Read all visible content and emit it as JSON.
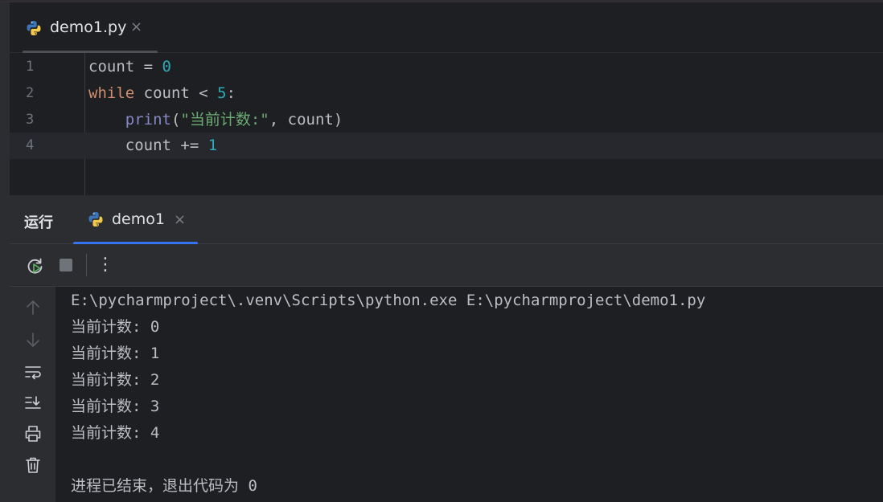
{
  "colors": {
    "background": "#1e1f22",
    "panel": "#2b2d30",
    "keyword": "#cf8e6d",
    "number": "#2aacb8",
    "builtin": "#8888c6",
    "string": "#6aab73",
    "accent": "#3574f0"
  },
  "editor": {
    "tab": {
      "filename": "demo1.py",
      "close_glyph": "×",
      "icon": "python-icon"
    },
    "lines": [
      {
        "num": "1"
      },
      {
        "num": "2"
      },
      {
        "num": "3"
      },
      {
        "num": "4"
      }
    ],
    "code": {
      "l1_var": "count",
      "l1_op": " = ",
      "l1_val": "0",
      "l2_kw": "while",
      "l2_rest": " count < ",
      "l2_val": "5",
      "l2_end": ":",
      "l3_indent": "    ",
      "l3_fn": "print",
      "l3_open": "(",
      "l3_str": "\"当前计数:\"",
      "l3_rest": ", count)",
      "l4_indent": "    ",
      "l4_var": "count",
      "l4_op": " += ",
      "l4_val": "1"
    }
  },
  "run": {
    "title": "运行",
    "tab": {
      "label": "demo1",
      "close_glyph": "×",
      "icon": "python-icon"
    },
    "toolbar": {
      "rerun_icon": "rerun-icon",
      "stop_icon": "stop-icon",
      "more_glyph": "⋮"
    },
    "side_icons": [
      "arrow-up-icon",
      "arrow-down-icon",
      "soft-wrap-icon",
      "scroll-to-end-icon",
      "print-icon",
      "trash-icon"
    ],
    "console": [
      "E:\\pycharmproject\\.venv\\Scripts\\python.exe E:\\pycharmproject\\demo1.py",
      "当前计数: 0",
      "当前计数: 1",
      "当前计数: 2",
      "当前计数: 3",
      "当前计数: 4",
      "",
      "进程已结束，退出代码为 0"
    ]
  }
}
